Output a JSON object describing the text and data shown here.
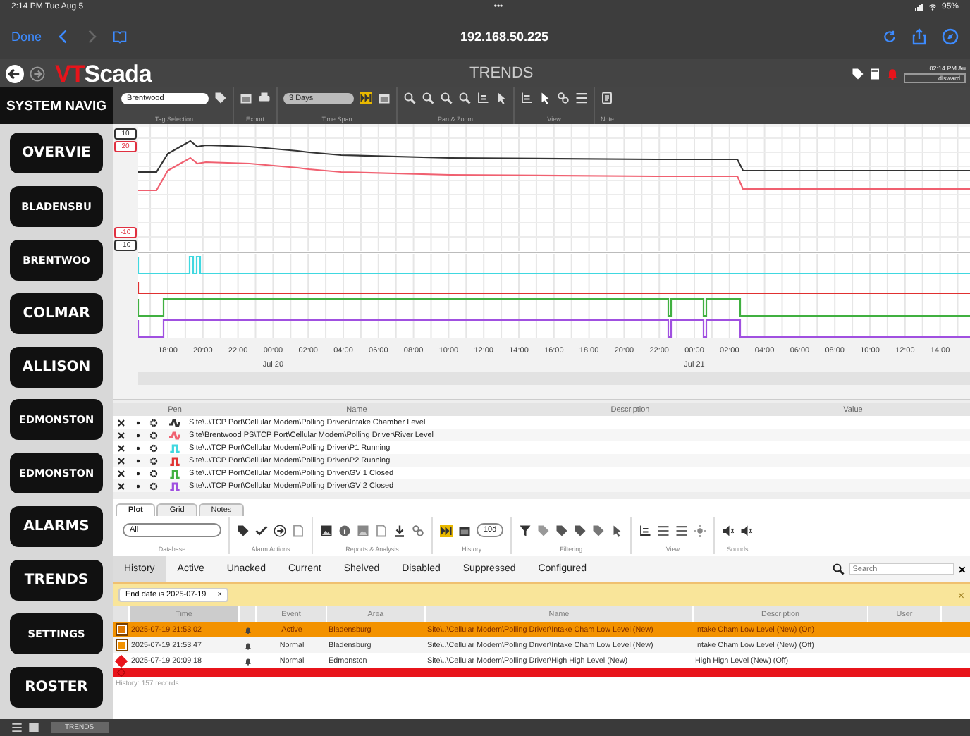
{
  "status_bar": {
    "time": "2:14 PM  Tue Aug 5",
    "dots": "•••",
    "battery": "95%"
  },
  "browser": {
    "done": "Done",
    "address": "192.168.50.225"
  },
  "header": {
    "logo": [
      "VT",
      "Scada"
    ],
    "title": "TRENDS",
    "clock": "02:14 PM Au",
    "user": "dlsward"
  },
  "nav": {
    "title": "SYSTEM NAVIG",
    "items": [
      "OVERVIE",
      "BLADENSBU",
      "BRENTWOO",
      "COLMAR",
      "ALLISON",
      "EDMONSTON",
      "EDMONSTON",
      "ALARMS",
      "TRENDS",
      "SETTINGS",
      "ROSTER"
    ]
  },
  "toolbar": {
    "tag": "Brentwood",
    "span": "3 Days",
    "groups": [
      "Tag Selection",
      "Export",
      "Time Span",
      "Pan & Zoom",
      "View",
      "Note"
    ]
  },
  "plot": {
    "top_labels": [
      {
        "text": "10",
        "color": "#333333"
      },
      {
        "text": "20",
        "color": "#e03040"
      }
    ],
    "bottom_labels": [
      {
        "text": "-10",
        "color": "#e03040"
      },
      {
        "text": "-10",
        "color": "#333333"
      }
    ],
    "ticks": [
      {
        "label": "18:00"
      },
      {
        "label": "20:00"
      },
      {
        "label": "22:00"
      },
      {
        "label": "00:00",
        "date": "Jul 20"
      },
      {
        "label": "02:00"
      },
      {
        "label": "04:00"
      },
      {
        "label": "06:00"
      },
      {
        "label": "08:00"
      },
      {
        "label": "10:00"
      },
      {
        "label": "12:00"
      },
      {
        "label": "14:00"
      },
      {
        "label": "16:00"
      },
      {
        "label": "18:00"
      },
      {
        "label": "20:00"
      },
      {
        "label": "22:00"
      },
      {
        "label": "00:00",
        "date": "Jul 21"
      },
      {
        "label": "02:00"
      },
      {
        "label": "04:00"
      },
      {
        "label": "06:00"
      },
      {
        "label": "08:00"
      },
      {
        "label": "10:00"
      },
      {
        "label": "12:00"
      },
      {
        "label": "14:00"
      }
    ]
  },
  "pens": {
    "columns": [
      "Pen",
      "Name",
      "Description",
      "Value"
    ],
    "rows": [
      {
        "kind": "analog",
        "color": "#333333",
        "name": "Site\\..\\TCP Port\\Cellular Modem\\Polling Driver\\Intake Chamber Level"
      },
      {
        "kind": "analog",
        "color": "#f06070",
        "name": "Site\\Brentwood PS\\TCP Port\\Cellular Modem\\Polling Driver\\River Level"
      },
      {
        "kind": "digital",
        "color": "#40d8e0",
        "name": "Site\\..\\TCP Port\\Cellular Modem\\Polling Driver\\P1 Running"
      },
      {
        "kind": "digital",
        "color": "#e03030",
        "name": "Site\\..\\TCP Port\\Cellular Modem\\Polling Driver\\P2 Running"
      },
      {
        "kind": "digital",
        "color": "#40b040",
        "name": "Site\\..\\TCP Port\\Cellular Modem\\Polling Driver\\GV 1 Closed"
      },
      {
        "kind": "digital",
        "color": "#a050e0",
        "name": "Site\\..\\TCP Port\\Cellular Modem\\Polling Driver\\GV 2 Closed"
      }
    ]
  },
  "plot_tabs": [
    {
      "label": "Plot",
      "selected": true
    },
    {
      "label": "Grid",
      "selected": false
    },
    {
      "label": "Notes",
      "selected": false
    }
  ],
  "alarm_toolbar": {
    "database": "All",
    "history": "10d",
    "groups": [
      "Database",
      "Alarm Actions",
      "Reports & Analysis",
      "History",
      "Filtering",
      "View",
      "Sounds"
    ]
  },
  "alarm_tabs": [
    {
      "label": "History",
      "selected": true
    },
    {
      "label": "Active",
      "selected": false
    },
    {
      "label": "Unacked",
      "selected": false
    },
    {
      "label": "Current",
      "selected": false
    },
    {
      "label": "Shelved",
      "selected": false
    },
    {
      "label": "Disabled",
      "selected": false
    },
    {
      "label": "Suppressed",
      "selected": false
    },
    {
      "label": "Configured",
      "selected": false
    }
  ],
  "search": {
    "placeholder": "Search",
    "clear": "×"
  },
  "filter": {
    "chip": "End date is 2025-07-19",
    "chip_close": "×",
    "close": "×"
  },
  "alarms": {
    "columns": [
      "Time",
      "Event",
      "Area",
      "Name",
      "Description",
      "User"
    ],
    "rows": [
      {
        "color": "#f39200",
        "icon": {
          "kind": "square",
          "color": "#e07800"
        },
        "time": "2025-07-19  21:53:02",
        "event": "Active",
        "area": "Bladensburg",
        "name": "Site\\..\\Cellular Modem\\Polling Driver\\Intake Cham Low Level (New)",
        "description": "Intake Cham Low Level (New) (On)"
      },
      {
        "color": "#f4f4f4",
        "icon": {
          "kind": "square",
          "color": "#f39200"
        },
        "time": "2025-07-19  21:53:47",
        "event": "Normal",
        "area": "Bladensburg",
        "name": "Site\\..\\Cellular Modem\\Polling Driver\\Intake Cham Low Level (New)",
        "description": "Intake Cham Low Level (New) (Off)"
      },
      {
        "color": "#ffffff",
        "icon": {
          "kind": "diamond",
          "color": "#e8141b"
        },
        "time": "2025-07-19  20:09:18",
        "event": "Normal",
        "area": "Edmonston",
        "name": "Site\\..\\Cellular Modem\\Polling Driver\\High High Level (New)",
        "description": "High High Level (New) (Off)"
      },
      {
        "color": "#e8141b",
        "icon": {
          "kind": "diamond",
          "color": "#e8141b"
        }
      }
    ],
    "footer": "History: 157 records"
  },
  "bottom": {
    "tab": "TRENDS"
  }
}
